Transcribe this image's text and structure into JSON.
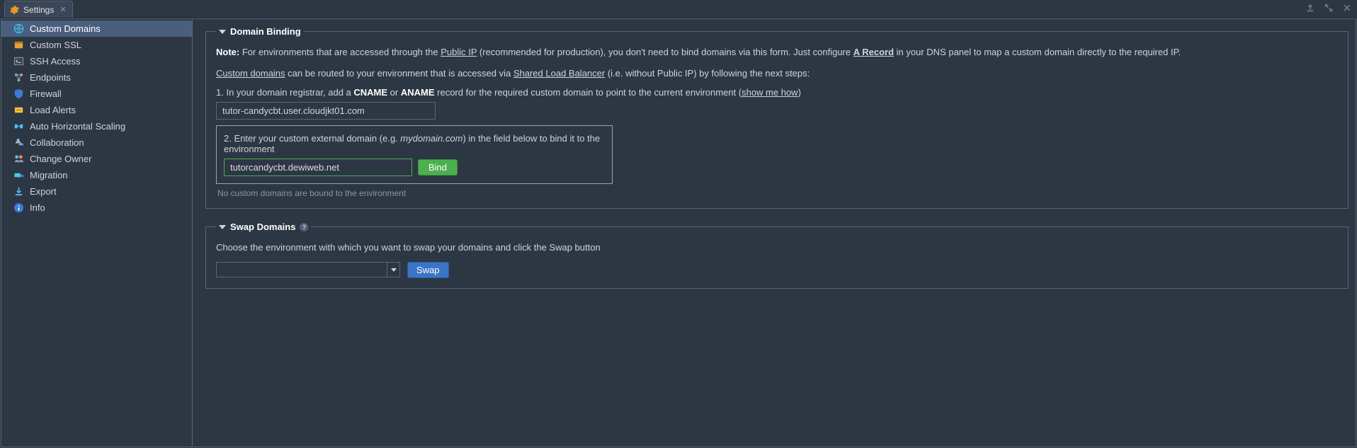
{
  "tab": {
    "title": "Settings"
  },
  "sidebar": {
    "items": [
      {
        "label": "Custom Domains",
        "icon": "globe",
        "active": true
      },
      {
        "label": "Custom SSL",
        "icon": "ssl",
        "active": false
      },
      {
        "label": "SSH Access",
        "icon": "terminal",
        "active": false
      },
      {
        "label": "Endpoints",
        "icon": "endpoints",
        "active": false
      },
      {
        "label": "Firewall",
        "icon": "shield",
        "active": false
      },
      {
        "label": "Load Alerts",
        "icon": "alert",
        "active": false
      },
      {
        "label": "Auto Horizontal Scaling",
        "icon": "scaling",
        "active": false
      },
      {
        "label": "Collaboration",
        "icon": "collab",
        "active": false
      },
      {
        "label": "Change Owner",
        "icon": "owner",
        "active": false
      },
      {
        "label": "Migration",
        "icon": "migration",
        "active": false
      },
      {
        "label": "Export",
        "icon": "export",
        "active": false
      },
      {
        "label": "Info",
        "icon": "info",
        "active": false
      }
    ]
  },
  "domain_binding": {
    "legend": "Domain Binding",
    "note_prefix": "Note:",
    "note_a": " For environments that are accessed through the ",
    "note_link1": "Public IP",
    "note_b": " (recommended for production), you don't need to bind domains via this form. Just configure ",
    "note_link2": "A Record",
    "note_c": " in your DNS panel to map a custom domain directly to the required IP.",
    "cd_link": "Custom domains",
    "cd_a": " can be routed to your environment that is accessed via ",
    "cd_link2": "Shared Load Balancer",
    "cd_b": " (i.e. without Public IP) by following the next steps:",
    "step1_a": "1. In your domain registrar, add a ",
    "step1_b1": "CNAME",
    "step1_or": " or ",
    "step1_b2": "ANAME",
    "step1_c": " record for the required custom domain to point to the current environment (",
    "step1_link": "show me how",
    "step1_d": ")",
    "cname_target": "tutor-candycbt.user.cloudjkt01.com",
    "step2_a": "2. Enter your custom external domain (e.g. ",
    "step2_eg": "mydomain.com",
    "step2_b": ") in the field below to bind it to the environment",
    "domain_input_value": "tutorcandycbt.dewiweb.net",
    "bind_label": "Bind",
    "status": "No custom domains are bound to the environment"
  },
  "swap": {
    "legend": "Swap Domains",
    "desc": "Choose the environment with which you want to swap your domains and click the Swap button",
    "selected_env": "",
    "swap_label": "Swap"
  }
}
